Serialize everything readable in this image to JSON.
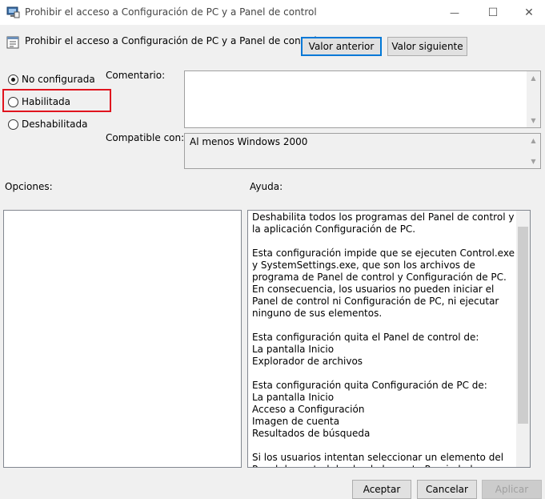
{
  "window": {
    "title": "Prohibir el acceso a Configuración de PC y a Panel de control",
    "minimize": "—",
    "maximize": "☐",
    "close": "✕"
  },
  "header": {
    "policy_name": "Prohibir el acceso a Configuración de PC y a Panel de control",
    "prev_button": "Valor anterior",
    "next_button": "Valor siguiente"
  },
  "state": {
    "options": [
      {
        "label": "No configurada",
        "checked": true
      },
      {
        "label": "Habilitada",
        "checked": false
      },
      {
        "label": "Deshabilitada",
        "checked": false
      }
    ]
  },
  "comment": {
    "label": "Comentario:",
    "value": ""
  },
  "supported": {
    "label": "Compatible con:",
    "value": "Al menos Windows 2000"
  },
  "options_panel": {
    "label": "Opciones:"
  },
  "help_panel": {
    "label": "Ayuda:",
    "paragraphs": [
      "Deshabilita todos los programas del Panel de control y la aplicación Configuración de PC.",
      "Esta configuración impide que se ejecuten Control.exe y SystemSettings.exe, que son los archivos de programa de Panel de control y Configuración de PC. En consecuencia, los usuarios no pueden iniciar el Panel de control ni Configuración de PC, ni ejecutar ninguno de sus elementos.",
      "Esta configuración quita el Panel de control de:\nLa pantalla Inicio\nExplorador de archivos",
      "Esta configuración quita Configuración de PC de:\nLa pantalla Inicio\nAcceso a Configuración\nImagen de cuenta\nResultados de búsqueda",
      "Si los usuarios intentan seleccionar un elemento del Panel de control desde el elemento Propiedades en un menú contextual, aparecerá un mensaje que explica que una configuración impide la acción."
    ]
  },
  "footer": {
    "ok": "Aceptar",
    "cancel": "Cancelar",
    "apply": "Aplicar"
  },
  "colors": {
    "accent": "#0078d7",
    "highlight": "#e0141e"
  }
}
